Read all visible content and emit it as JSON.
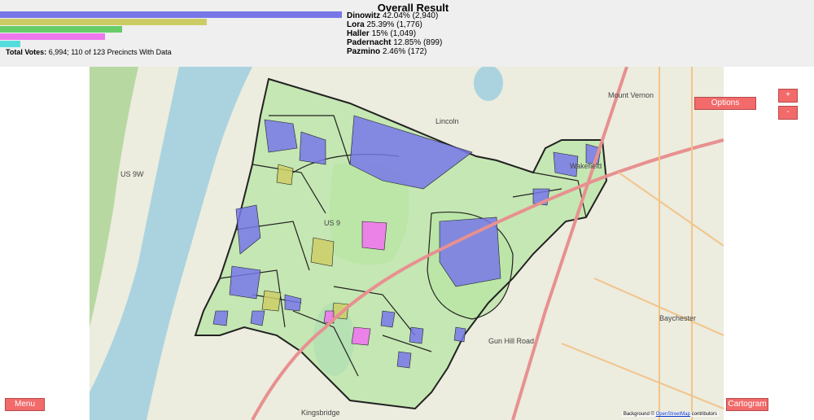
{
  "header": {
    "title": "Overall Result",
    "total_label": "Total Votes:",
    "total_value": "6,994; 110 of 123 Precincts With Data"
  },
  "candidates": [
    {
      "name": "Dinowitz",
      "pct": "42.04%",
      "votes": "(2,940)",
      "share": 0.4204,
      "color": "#7777e8"
    },
    {
      "name": "Lora",
      "pct": "25.39%",
      "votes": "(1,776)",
      "share": 0.2539,
      "color": "#cccc66"
    },
    {
      "name": "Haller",
      "pct": "15%",
      "votes": "(1,049)",
      "share": 0.15,
      "color": "#66cc66"
    },
    {
      "name": "Padernacht",
      "pct": "12.85%",
      "votes": "(899)",
      "share": 0.1285,
      "color": "#ee77ee"
    },
    {
      "name": "Pazmino",
      "pct": "2.46%",
      "votes": "(172)",
      "share": 0.0246,
      "color": "#55dddd"
    }
  ],
  "buttons": {
    "options": "Options",
    "zoom_in": "+",
    "zoom_out": "-",
    "menu": "Menu",
    "cartogram": "Cartogram"
  },
  "attribution": {
    "prefix": "Background ©",
    "link": "OpenStreetMap",
    "suffix": "contributors"
  },
  "map_labels": {
    "mount_vernon": "Mount Vernon",
    "wakefield": "Wakefield",
    "baychester": "Baychester",
    "gun_hill": "Gun Hill Road",
    "kingsbridge": "Kingsbridge",
    "lincoln": "Lincoln",
    "route_9w": "US 9W",
    "route_9": "US 9"
  },
  "colors": {
    "water": "#aad3df",
    "park": "#c8e6b4",
    "district": "#b8e6a4",
    "map_base": "#ececdf"
  }
}
